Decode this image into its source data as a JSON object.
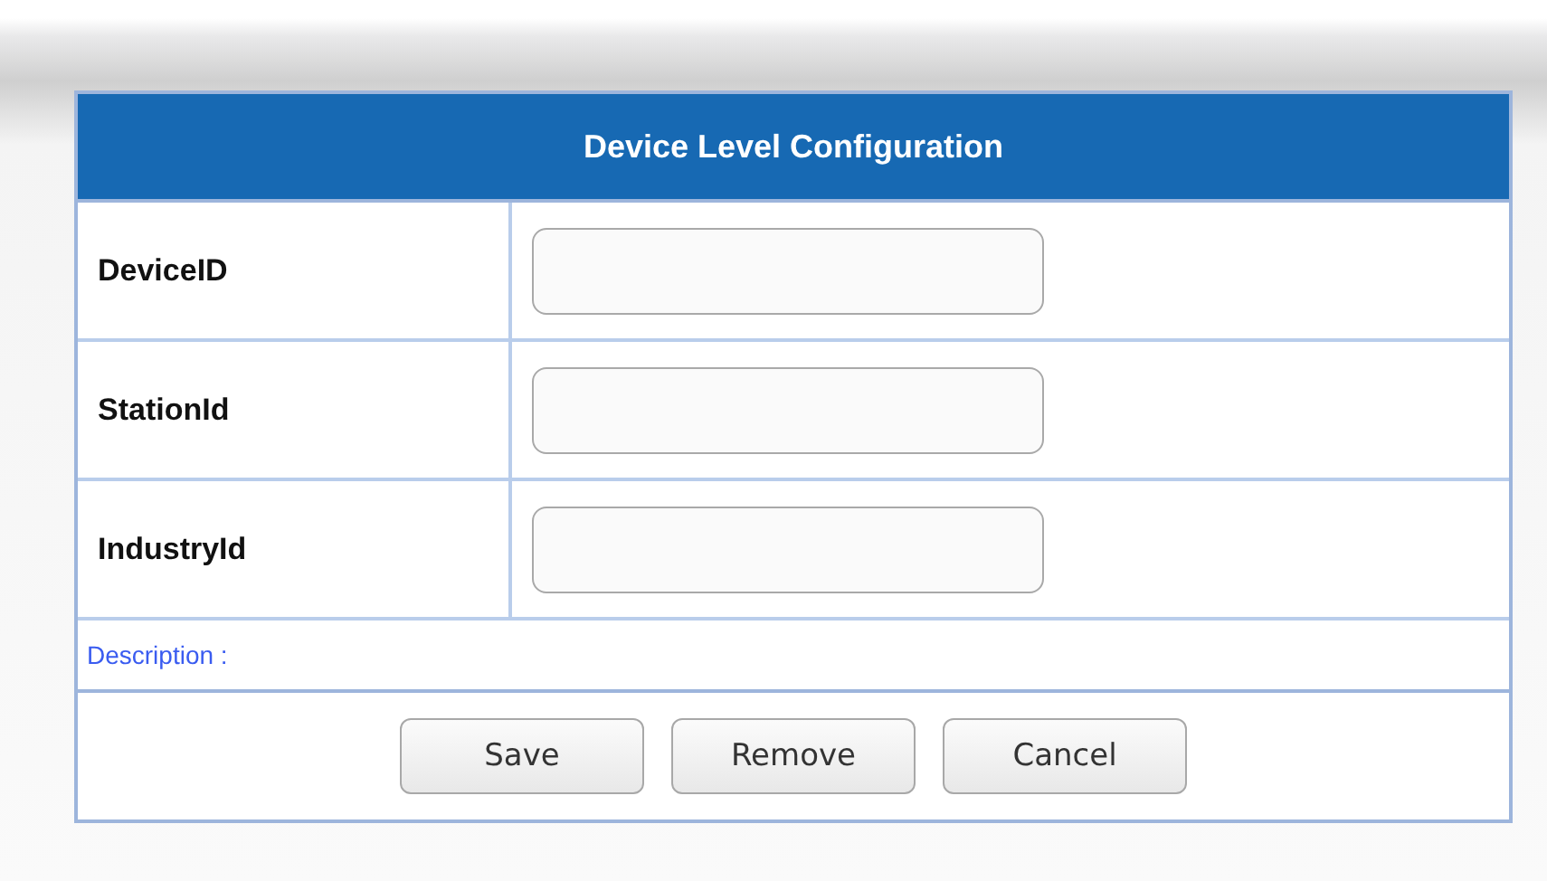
{
  "dialog": {
    "title": "Device Level Configuration",
    "fields": [
      {
        "label": "DeviceID"
      },
      {
        "label": "StationId"
      },
      {
        "label": "IndustryId"
      }
    ],
    "description_label": "Description :",
    "buttons": [
      "Save",
      "Remove",
      "Cancel"
    ]
  }
}
